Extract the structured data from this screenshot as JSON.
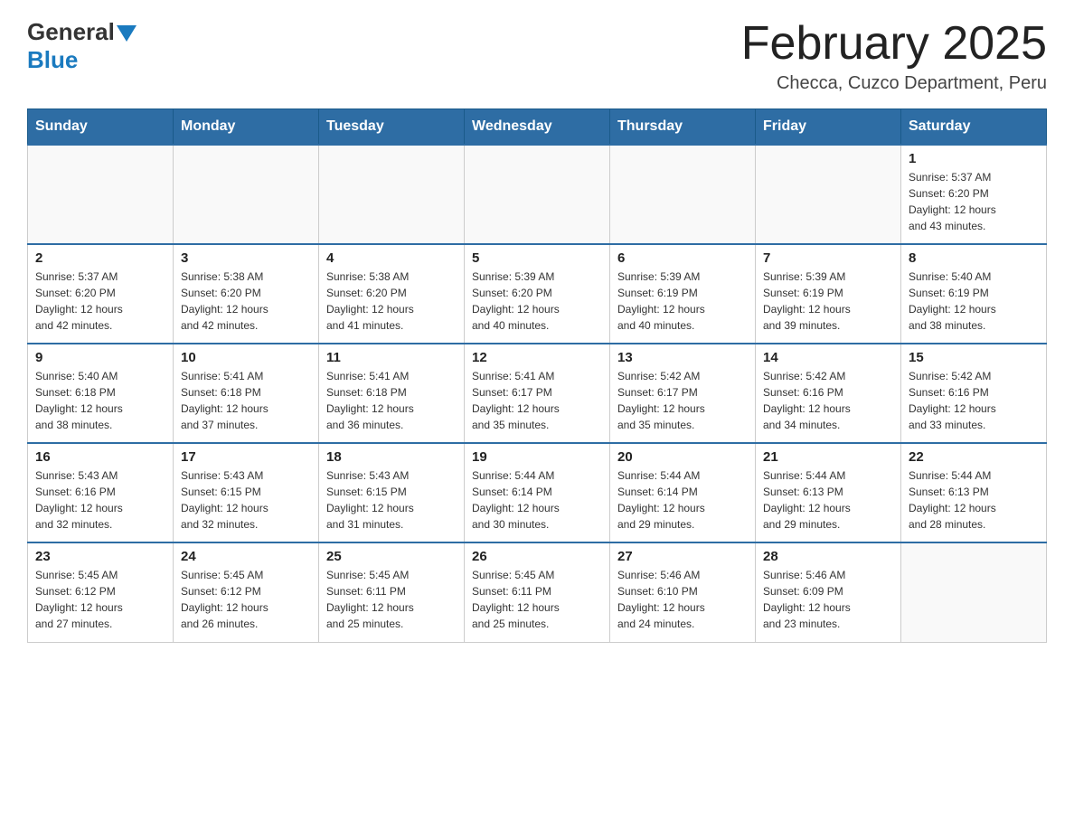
{
  "header": {
    "logo_general": "General",
    "logo_blue": "Blue",
    "month_title": "February 2025",
    "location": "Checca, Cuzco Department, Peru"
  },
  "weekdays": [
    "Sunday",
    "Monday",
    "Tuesday",
    "Wednesday",
    "Thursday",
    "Friday",
    "Saturday"
  ],
  "weeks": [
    [
      {
        "day": "",
        "info": ""
      },
      {
        "day": "",
        "info": ""
      },
      {
        "day": "",
        "info": ""
      },
      {
        "day": "",
        "info": ""
      },
      {
        "day": "",
        "info": ""
      },
      {
        "day": "",
        "info": ""
      },
      {
        "day": "1",
        "info": "Sunrise: 5:37 AM\nSunset: 6:20 PM\nDaylight: 12 hours\nand 43 minutes."
      }
    ],
    [
      {
        "day": "2",
        "info": "Sunrise: 5:37 AM\nSunset: 6:20 PM\nDaylight: 12 hours\nand 42 minutes."
      },
      {
        "day": "3",
        "info": "Sunrise: 5:38 AM\nSunset: 6:20 PM\nDaylight: 12 hours\nand 42 minutes."
      },
      {
        "day": "4",
        "info": "Sunrise: 5:38 AM\nSunset: 6:20 PM\nDaylight: 12 hours\nand 41 minutes."
      },
      {
        "day": "5",
        "info": "Sunrise: 5:39 AM\nSunset: 6:20 PM\nDaylight: 12 hours\nand 40 minutes."
      },
      {
        "day": "6",
        "info": "Sunrise: 5:39 AM\nSunset: 6:19 PM\nDaylight: 12 hours\nand 40 minutes."
      },
      {
        "day": "7",
        "info": "Sunrise: 5:39 AM\nSunset: 6:19 PM\nDaylight: 12 hours\nand 39 minutes."
      },
      {
        "day": "8",
        "info": "Sunrise: 5:40 AM\nSunset: 6:19 PM\nDaylight: 12 hours\nand 38 minutes."
      }
    ],
    [
      {
        "day": "9",
        "info": "Sunrise: 5:40 AM\nSunset: 6:18 PM\nDaylight: 12 hours\nand 38 minutes."
      },
      {
        "day": "10",
        "info": "Sunrise: 5:41 AM\nSunset: 6:18 PM\nDaylight: 12 hours\nand 37 minutes."
      },
      {
        "day": "11",
        "info": "Sunrise: 5:41 AM\nSunset: 6:18 PM\nDaylight: 12 hours\nand 36 minutes."
      },
      {
        "day": "12",
        "info": "Sunrise: 5:41 AM\nSunset: 6:17 PM\nDaylight: 12 hours\nand 35 minutes."
      },
      {
        "day": "13",
        "info": "Sunrise: 5:42 AM\nSunset: 6:17 PM\nDaylight: 12 hours\nand 35 minutes."
      },
      {
        "day": "14",
        "info": "Sunrise: 5:42 AM\nSunset: 6:16 PM\nDaylight: 12 hours\nand 34 minutes."
      },
      {
        "day": "15",
        "info": "Sunrise: 5:42 AM\nSunset: 6:16 PM\nDaylight: 12 hours\nand 33 minutes."
      }
    ],
    [
      {
        "day": "16",
        "info": "Sunrise: 5:43 AM\nSunset: 6:16 PM\nDaylight: 12 hours\nand 32 minutes."
      },
      {
        "day": "17",
        "info": "Sunrise: 5:43 AM\nSunset: 6:15 PM\nDaylight: 12 hours\nand 32 minutes."
      },
      {
        "day": "18",
        "info": "Sunrise: 5:43 AM\nSunset: 6:15 PM\nDaylight: 12 hours\nand 31 minutes."
      },
      {
        "day": "19",
        "info": "Sunrise: 5:44 AM\nSunset: 6:14 PM\nDaylight: 12 hours\nand 30 minutes."
      },
      {
        "day": "20",
        "info": "Sunrise: 5:44 AM\nSunset: 6:14 PM\nDaylight: 12 hours\nand 29 minutes."
      },
      {
        "day": "21",
        "info": "Sunrise: 5:44 AM\nSunset: 6:13 PM\nDaylight: 12 hours\nand 29 minutes."
      },
      {
        "day": "22",
        "info": "Sunrise: 5:44 AM\nSunset: 6:13 PM\nDaylight: 12 hours\nand 28 minutes."
      }
    ],
    [
      {
        "day": "23",
        "info": "Sunrise: 5:45 AM\nSunset: 6:12 PM\nDaylight: 12 hours\nand 27 minutes."
      },
      {
        "day": "24",
        "info": "Sunrise: 5:45 AM\nSunset: 6:12 PM\nDaylight: 12 hours\nand 26 minutes."
      },
      {
        "day": "25",
        "info": "Sunrise: 5:45 AM\nSunset: 6:11 PM\nDaylight: 12 hours\nand 25 minutes."
      },
      {
        "day": "26",
        "info": "Sunrise: 5:45 AM\nSunset: 6:11 PM\nDaylight: 12 hours\nand 25 minutes."
      },
      {
        "day": "27",
        "info": "Sunrise: 5:46 AM\nSunset: 6:10 PM\nDaylight: 12 hours\nand 24 minutes."
      },
      {
        "day": "28",
        "info": "Sunrise: 5:46 AM\nSunset: 6:09 PM\nDaylight: 12 hours\nand 23 minutes."
      },
      {
        "day": "",
        "info": ""
      }
    ]
  ]
}
